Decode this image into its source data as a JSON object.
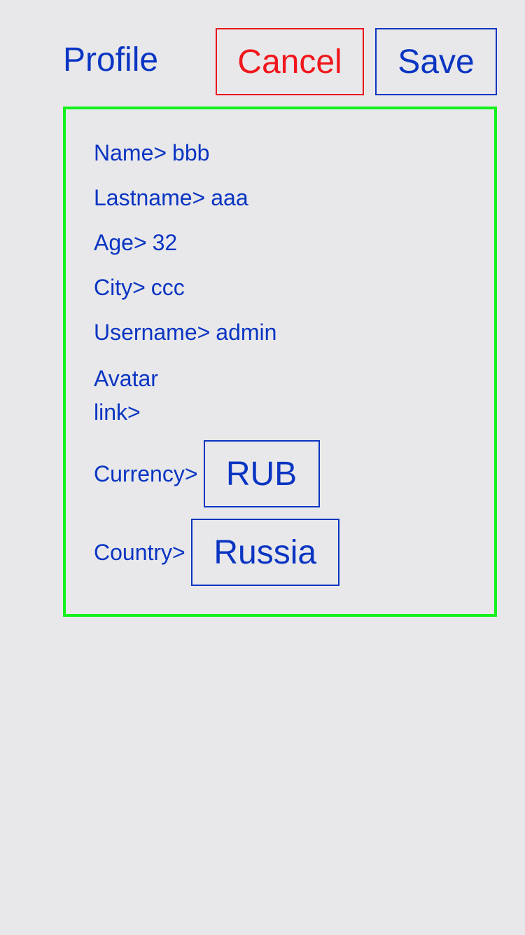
{
  "header": {
    "title": "Profile",
    "cancel_label": "Cancel",
    "save_label": "Save"
  },
  "profile": {
    "name_label": "Name>",
    "name_value": "bbb",
    "lastname_label": "Lastname>",
    "lastname_value": "aaa",
    "age_label": "Age>",
    "age_value": "32",
    "city_label": "City>",
    "city_value": "ccc",
    "username_label": "Username>",
    "username_value": "admin",
    "avatar_label": "Avatar link>",
    "avatar_value": "",
    "currency_label": "Currency>",
    "currency_value": "RUB",
    "country_label": "Country>",
    "country_value": "Russia"
  },
  "colors": {
    "text": "#0a35c2",
    "cancel": "#f0161b",
    "card_border": "#12f21a",
    "background": "#e8e8eb"
  }
}
